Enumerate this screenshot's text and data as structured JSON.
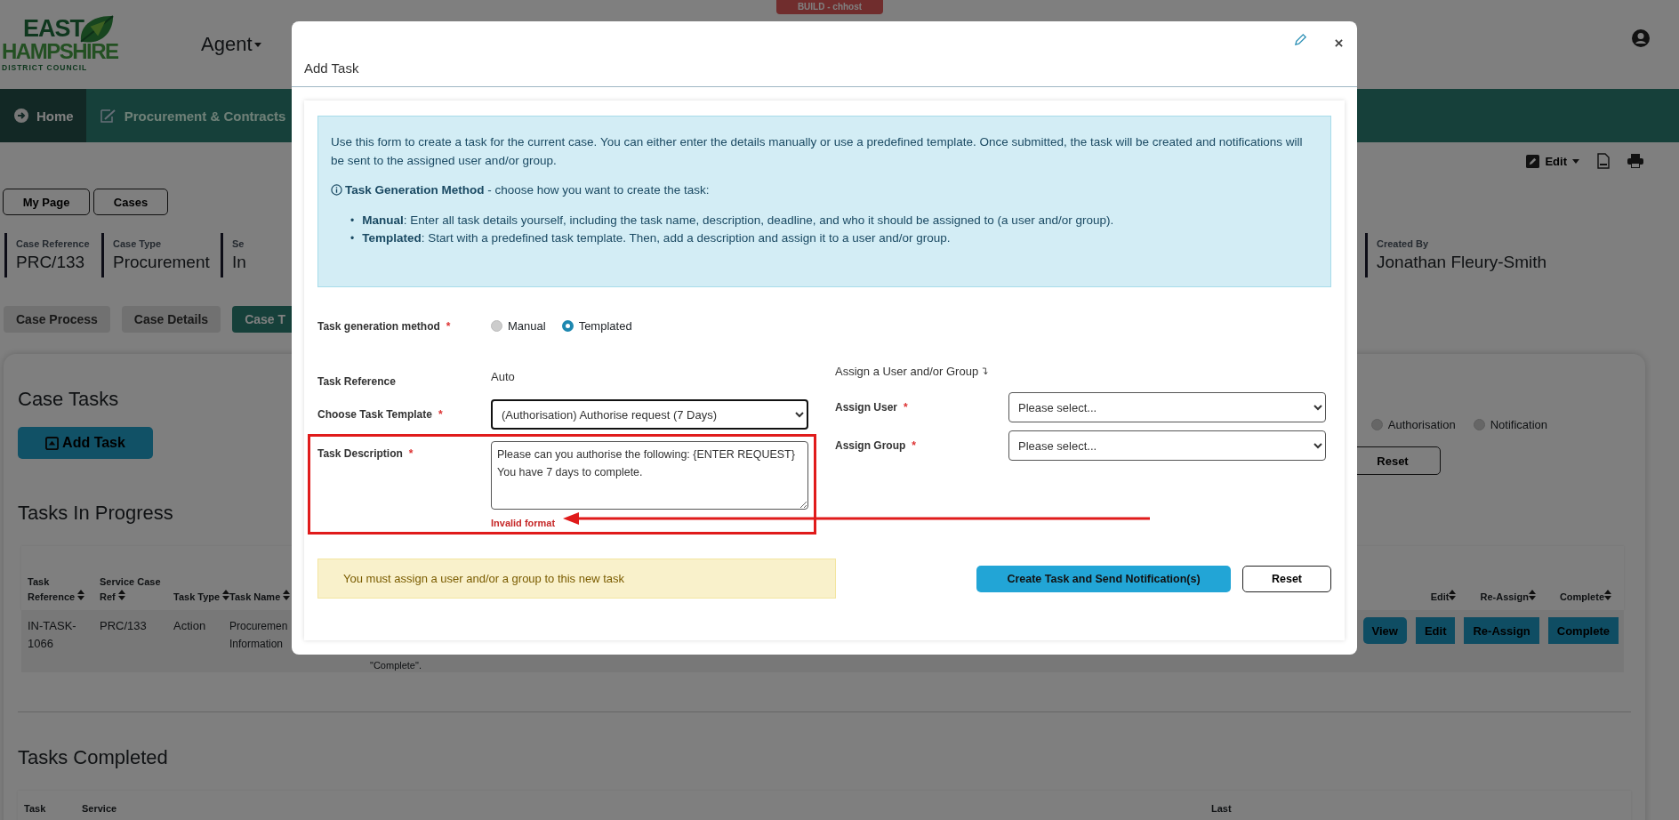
{
  "header": {
    "build_badge": "BUILD - chhost",
    "logo": {
      "line_1": "EAST",
      "line_2": "HAMPSHIRE",
      "line_3": "DISTRICT COUNCIL"
    },
    "agent_menu": "Agent"
  },
  "nav": [
    {
      "label": "Home",
      "selected": true
    },
    {
      "label": "Procurement & Contracts",
      "selected": false
    }
  ],
  "toolbar": {
    "edit": "Edit"
  },
  "quick_links": [
    "My Page",
    "Cases"
  ],
  "case_fields": [
    {
      "label": "Case Reference",
      "value": "PRC/133"
    },
    {
      "label": "Case Type",
      "value": "Procurement"
    },
    {
      "label": "Se",
      "value": "In"
    },
    {
      "label": "Created By",
      "value": "Jonathan Fleury-Smith"
    }
  ],
  "case_tabs": [
    {
      "label": "Case Process",
      "selected": false
    },
    {
      "label": "Case Details",
      "selected": false
    },
    {
      "label": "Case T",
      "selected": true
    }
  ],
  "case_tasks": {
    "title": "Case Tasks",
    "add_button": "Add Task",
    "filters": [
      {
        "label": "Authorisation",
        "checked": false
      },
      {
        "label": "Notification",
        "checked": false
      }
    ],
    "reset_button": "Reset"
  },
  "in_progress": {
    "title": "Tasks In Progress",
    "columns": [
      "Task Reference",
      "Service Case Ref",
      "Task Type",
      "Task Name"
    ],
    "action_columns": [
      "Edit",
      "Re-Assign",
      "Complete"
    ],
    "rows": [
      {
        "reference": "IN-TASK-1066",
        "case_ref": "PRC/133",
        "type": "Action",
        "name_lines": [
          "Procuremen",
          "Information"
        ],
        "description_tail": "\"Complete\".",
        "actions": [
          "View",
          "Edit",
          "Re-Assign",
          "Complete"
        ]
      }
    ]
  },
  "completed": {
    "title": "Tasks Completed",
    "columns": [
      "Task",
      "Service",
      "Last"
    ]
  },
  "modal": {
    "title": "Add Task",
    "intro": "Use this form to create a task for the current case. You can either enter the details manually or use a predefined template. Once submitted, the task will be created and notifications will be sent to the assigned user and/or group.",
    "method_heading": "**Task Generation Method** - choose how you want to create the task:",
    "bullets": [
      {
        "marker": "•",
        "text": "**Manual**: Enter all task details yourself, including the task name, description, deadline, and who it should be assigned to (a user and/or group)."
      },
      {
        "marker": "•",
        "text": "**Templated**: Start with a predefined task template. Then, add a description and assign it to a user and/or group."
      }
    ],
    "generation_method": {
      "label": "Task generation method",
      "required_mark": "*",
      "options": [
        {
          "label": "Manual",
          "selected": false
        },
        {
          "label": "Templated",
          "selected": true
        }
      ]
    },
    "task_reference": {
      "label": "Task Reference",
      "value": "Auto"
    },
    "template": {
      "label": "Choose Task Template",
      "required_mark": "*",
      "value": "(Authorisation) Authorise request (7 Days)"
    },
    "description": {
      "label": "Task Description",
      "required_mark": "*",
      "value": "Please can you authorise the following: {ENTER REQUEST}\nYou have 7 days to complete.",
      "error": "Invalid format"
    },
    "assign_heading": "Assign a User and/or Group",
    "assign_user": {
      "label": "Assign User",
      "required_mark": "*",
      "value": "Please select..."
    },
    "assign_group": {
      "label": "Assign Group",
      "required_mark": "*",
      "value": "Please select..."
    },
    "alert": "You must assign a user and/or a group to this new task",
    "submit_button": "Create Task and Send Notification(s)",
    "reset_button": "Reset"
  }
}
